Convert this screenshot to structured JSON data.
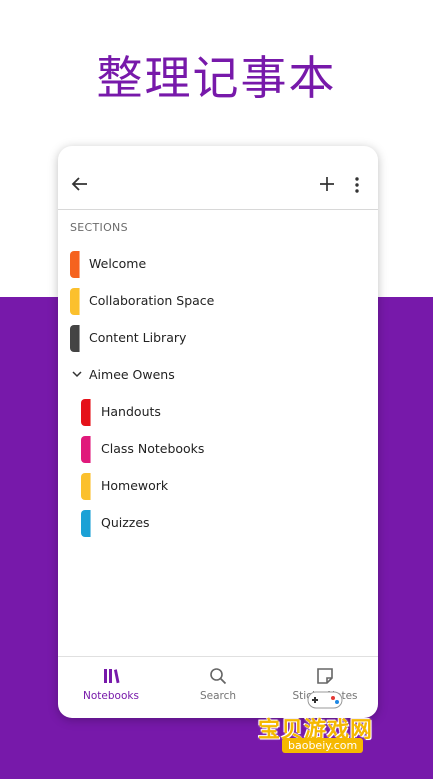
{
  "headline": "整理记事本",
  "header": {
    "back_icon": "arrow-left-icon",
    "add_icon": "plus-icon",
    "more_icon": "more-vertical-icon"
  },
  "sections_label": "SECTIONS",
  "sections": [
    {
      "label": "Welcome",
      "color": "#F5631F"
    },
    {
      "label": "Collaboration Space",
      "color": "#FBC02D"
    },
    {
      "label": "Content Library",
      "color": "#444444"
    }
  ],
  "group": {
    "label": "Aimee Owens",
    "items": [
      {
        "label": "Handouts",
        "color": "#E5121A"
      },
      {
        "label": "Class Notebooks",
        "color": "#E0197B"
      },
      {
        "label": "Homework",
        "color": "#FBC02D"
      },
      {
        "label": "Quizzes",
        "color": "#1BA1D6"
      }
    ]
  },
  "nav": {
    "notebooks": "Notebooks",
    "search": "Search",
    "sticky": "Sticky Notes"
  },
  "watermark": {
    "title": "宝贝游戏网",
    "sub": "baobeiy.com"
  },
  "colors": {
    "brand": "#7719AA"
  }
}
